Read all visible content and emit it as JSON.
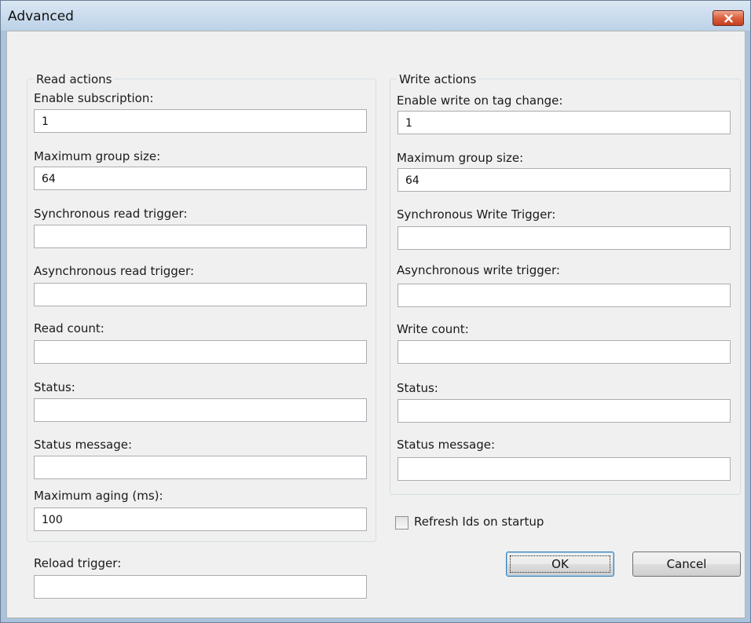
{
  "window": {
    "title": "Advanced",
    "close_icon": "close-icon"
  },
  "read_group": {
    "legend": "Read actions",
    "fields": [
      {
        "label": "Enable subscription:",
        "value": "1"
      },
      {
        "label": "Maximum group size:",
        "value": "64"
      },
      {
        "label": "Synchronous read trigger:",
        "value": ""
      },
      {
        "label": "Asynchronous read trigger:",
        "value": ""
      },
      {
        "label": "Read count:",
        "value": ""
      },
      {
        "label": "Status:",
        "value": ""
      },
      {
        "label": "Status message:",
        "value": ""
      },
      {
        "label": "Maximum aging (ms):",
        "value": "100"
      }
    ]
  },
  "write_group": {
    "legend": "Write actions",
    "fields": [
      {
        "label": "Enable write on tag change:",
        "value": "1"
      },
      {
        "label": "Maximum group size:",
        "value": "64"
      },
      {
        "label": "Synchronous Write Trigger:",
        "value": ""
      },
      {
        "label": "Asynchronous write trigger:",
        "value": ""
      },
      {
        "label": "Write count:",
        "value": ""
      },
      {
        "label": "Status:",
        "value": ""
      },
      {
        "label": "Status message:",
        "value": ""
      }
    ]
  },
  "reload": {
    "label": "Reload trigger:",
    "value": ""
  },
  "refresh_checkbox": {
    "label": "Refresh Ids on startup",
    "checked": false
  },
  "buttons": {
    "ok": "OK",
    "cancel": "Cancel"
  }
}
